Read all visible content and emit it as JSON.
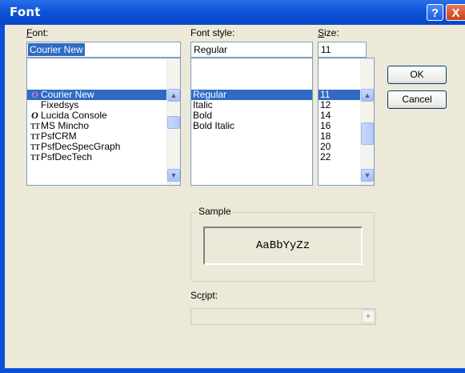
{
  "window": {
    "title": "Font",
    "help_label": "?",
    "close_label": "X"
  },
  "font": {
    "label": "Font:",
    "mnemonic": "F",
    "label_rest": "ont:",
    "value": "Courier New",
    "items": [
      {
        "icon": "opentype-icon",
        "glyph": "O",
        "label": "Courier New",
        "selected": true
      },
      {
        "icon": "",
        "glyph": "",
        "label": "Fixedsys",
        "selected": false
      },
      {
        "icon": "opentype-icon",
        "glyph": "O",
        "label": "Lucida Console",
        "selected": false
      },
      {
        "icon": "truetype-icon",
        "glyph": "TT",
        "label": "MS Mincho",
        "selected": false
      },
      {
        "icon": "truetype-icon",
        "glyph": "TT",
        "label": "PsfCRM",
        "selected": false
      },
      {
        "icon": "truetype-icon",
        "glyph": "TT",
        "label": "PsfDecSpecGraph",
        "selected": false
      },
      {
        "icon": "truetype-icon",
        "glyph": "TT",
        "label": "PsfDecTech",
        "selected": false
      }
    ]
  },
  "style": {
    "label": "Font style:",
    "value": "Regular",
    "items": [
      {
        "label": "Regular",
        "selected": true
      },
      {
        "label": "Italic",
        "selected": false
      },
      {
        "label": "Bold",
        "selected": false
      },
      {
        "label": "Bold Italic",
        "selected": false
      }
    ]
  },
  "size": {
    "label": "Size:",
    "mnemonic": "S",
    "label_rest": "ize:",
    "value": "11",
    "items": [
      {
        "label": "11",
        "selected": true
      },
      {
        "label": "12",
        "selected": false
      },
      {
        "label": "14",
        "selected": false
      },
      {
        "label": "16",
        "selected": false
      },
      {
        "label": "18",
        "selected": false
      },
      {
        "label": "20",
        "selected": false
      },
      {
        "label": "22",
        "selected": false
      }
    ]
  },
  "buttons": {
    "ok": "OK",
    "cancel": "Cancel"
  },
  "sample": {
    "group_label": "Sample",
    "text": "AaBbYyZz"
  },
  "script": {
    "label": "Script:",
    "mnemonic": "r",
    "label_pre": "Sc",
    "label_post": "ipt:",
    "value": ""
  }
}
